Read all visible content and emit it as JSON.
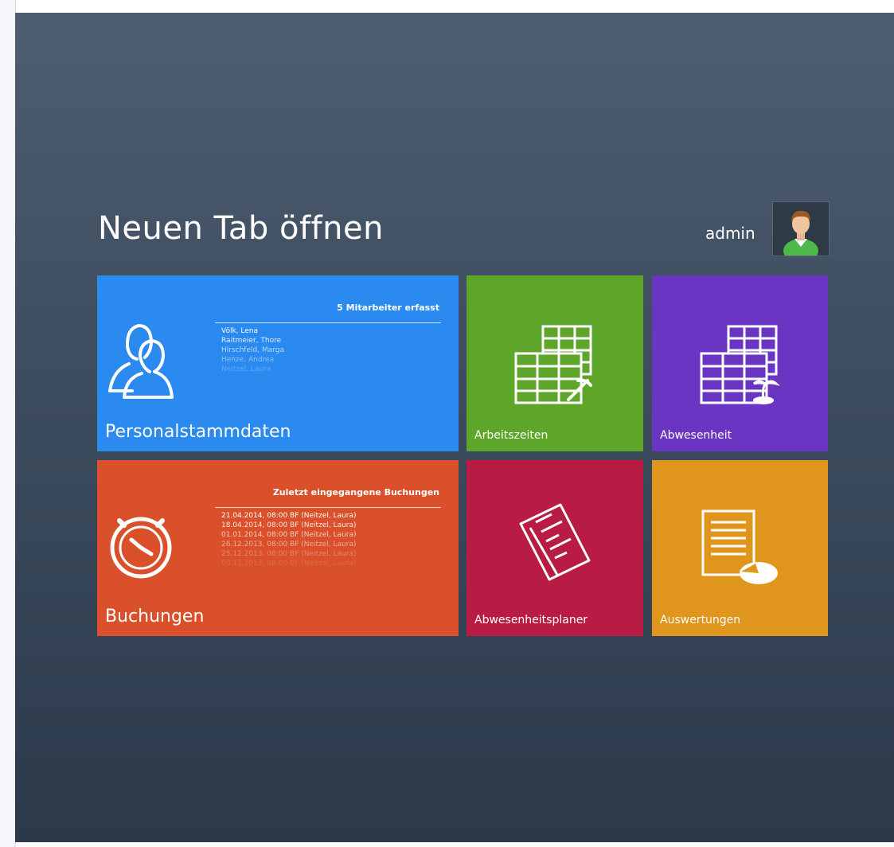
{
  "header": {
    "title": "Neuen Tab öffnen",
    "user": "admin"
  },
  "tiles": {
    "personal": {
      "label": "Personalstammdaten",
      "panel_title": "5 Mitarbeiter erfasst",
      "items": [
        "Völk, Lena",
        "Raitmeier, Thore",
        "Hirschfeld, Marga",
        "Henze, Andrea",
        "Neitzel, Laura"
      ]
    },
    "arbeitszeiten": {
      "label": "Arbeitszeiten"
    },
    "abwesenheit": {
      "label": "Abwesenheit"
    },
    "buchungen": {
      "label": "Buchungen",
      "panel_title": "Zuletzt eingegangene Buchungen",
      "items": [
        "21.04.2014, 08:00  BF  (Neitzel, Laura)",
        "18.04.2014, 08:00  BF  (Neitzel, Laura)",
        "01.01.2014, 08:00  BF  (Neitzel, Laura)",
        "26.12.2013, 08:00  BF  (Neitzel, Laura)",
        "25.12.2013, 08:00  BF  (Neitzel, Laura)",
        "09.11.2013, 08:00  BF  (Neitzel, Laura)"
      ]
    },
    "abwesenheitsplaner": {
      "label": "Abwesenheitsplaner"
    },
    "auswertungen": {
      "label": "Auswertungen"
    }
  },
  "icons": {
    "personal": "people-icon",
    "arbeitszeiten": "table-pick-icon",
    "abwesenheit": "table-palm-icon",
    "buchungen": "stopwatch-icon",
    "abwesenheitsplaner": "planner-icon",
    "auswertungen": "report-chart-icon",
    "avatar": "user-avatar-icon"
  },
  "colors": {
    "personal": "#2a8af0",
    "arbeitszeiten": "#5ea62a",
    "abwesenheit": "#6a35c2",
    "buchungen": "#d9502a",
    "abwesenheitsplaner": "#b81c44",
    "auswertungen": "#e0951c"
  }
}
